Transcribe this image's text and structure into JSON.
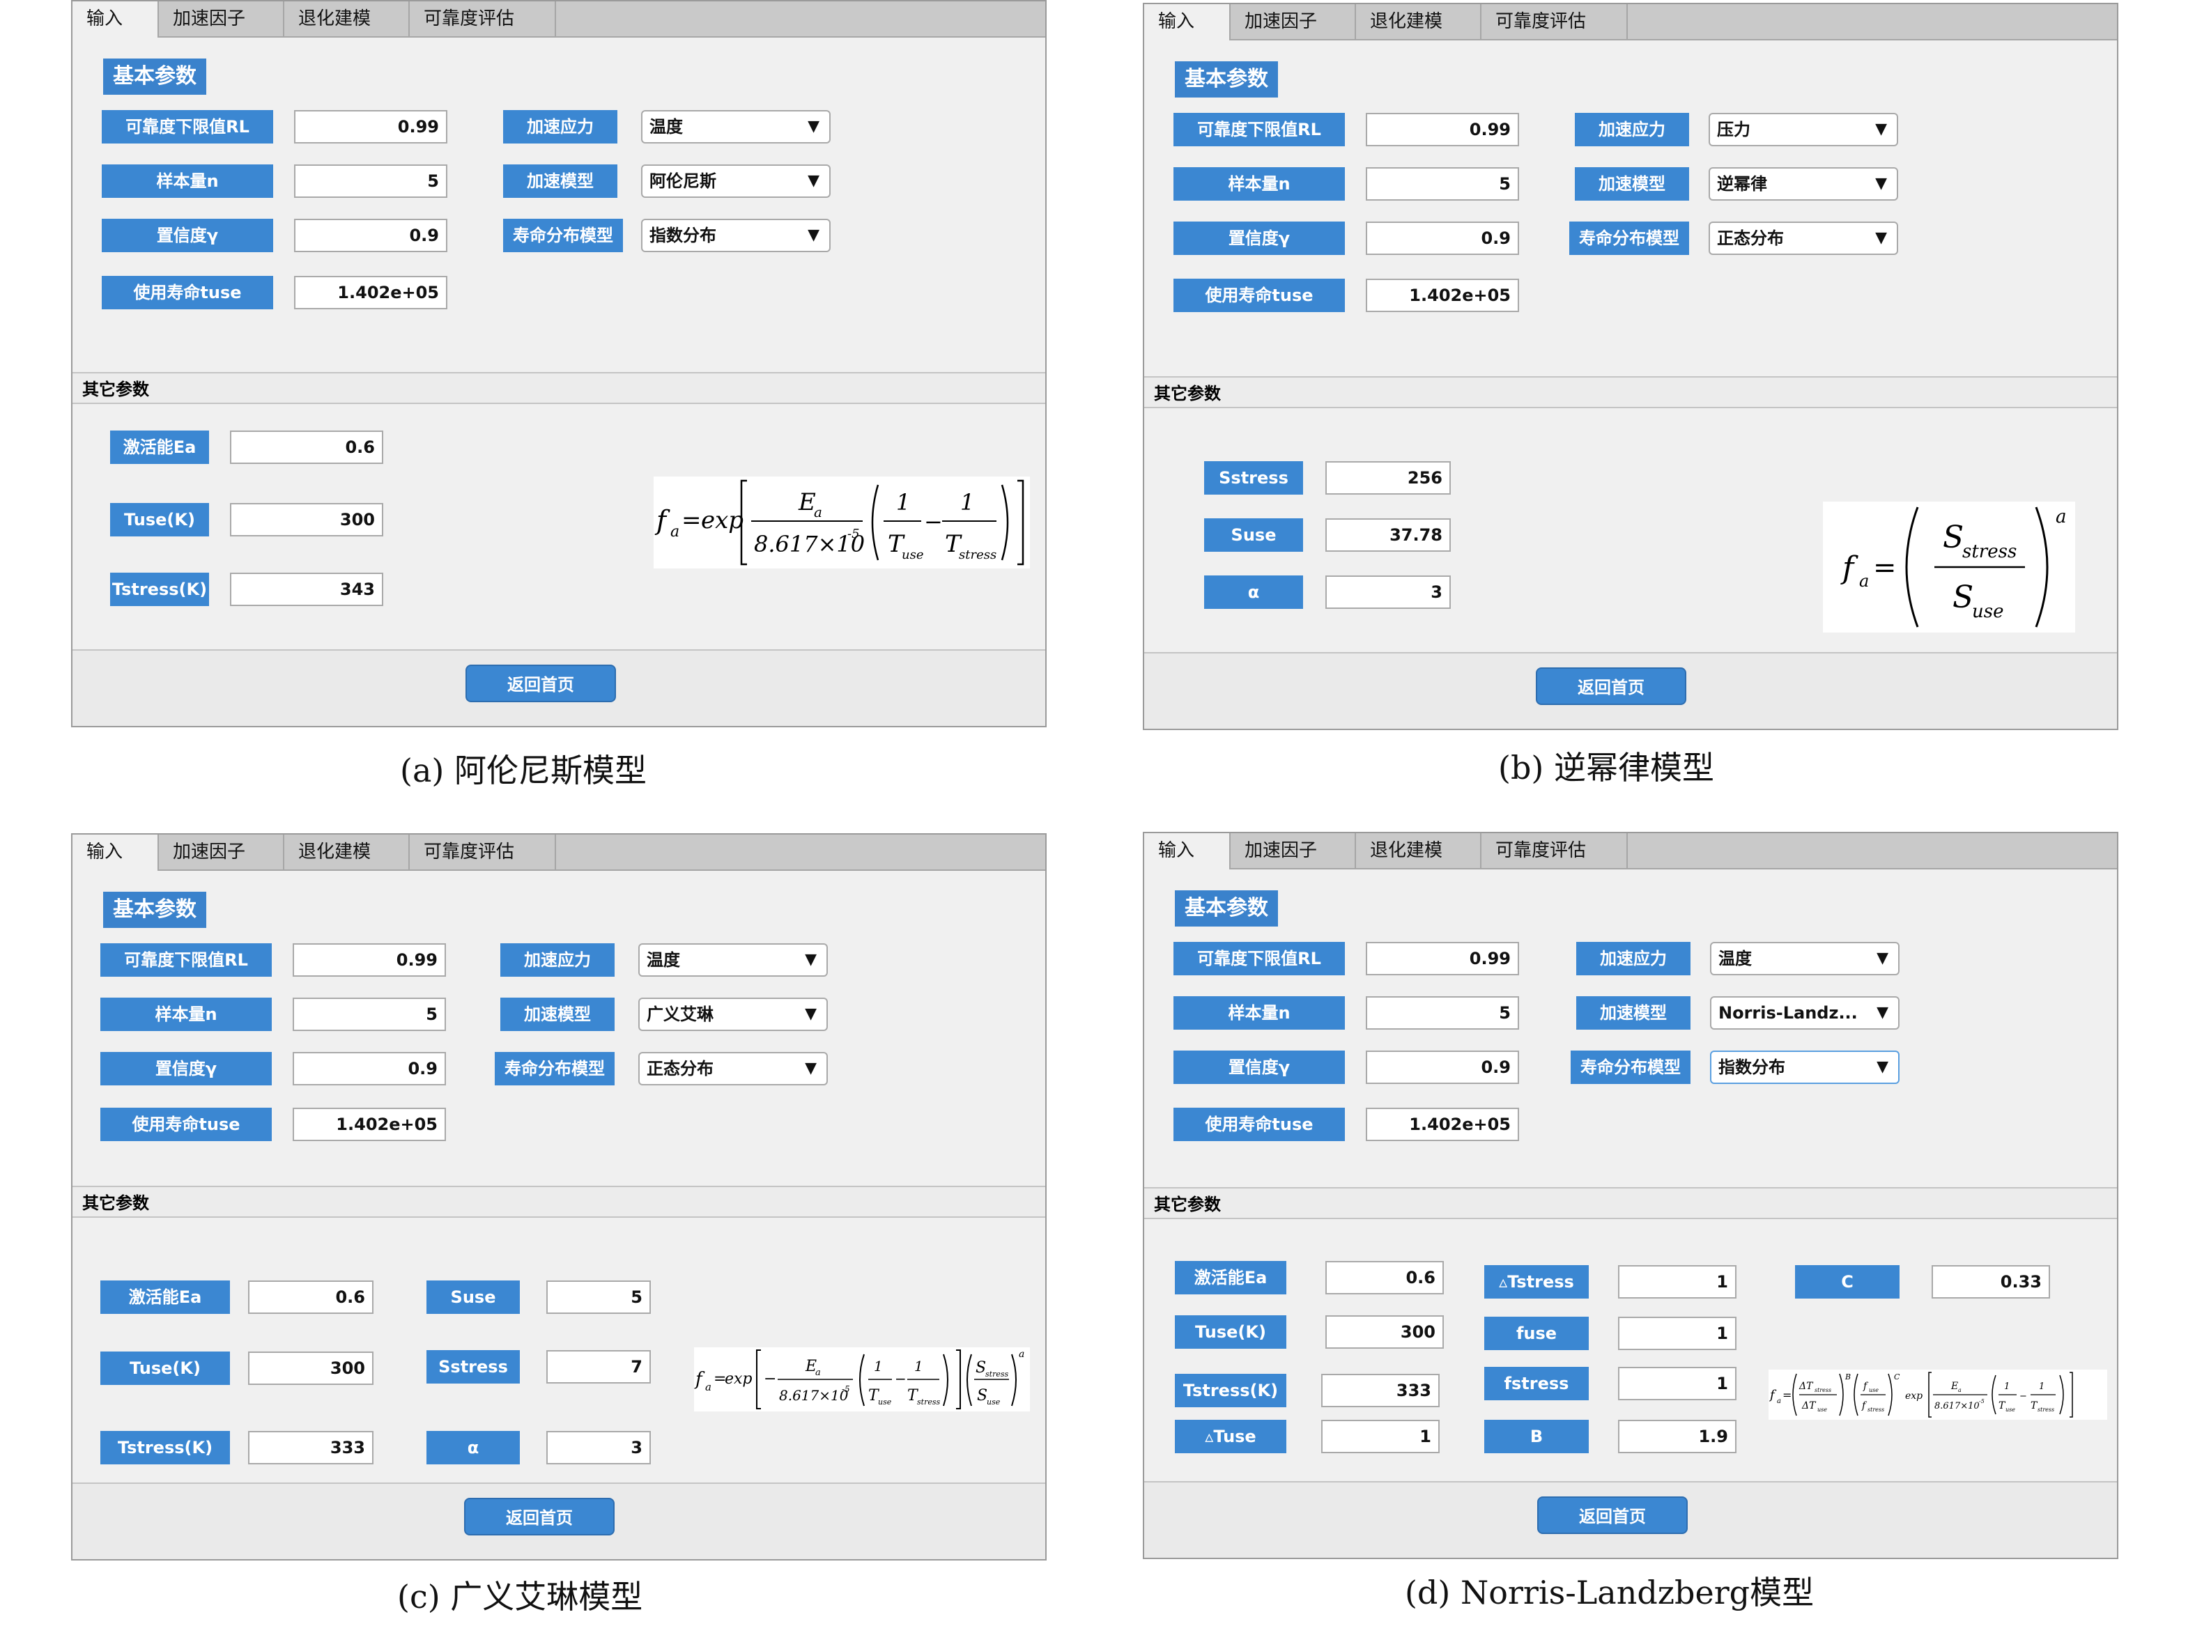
{
  "tabs": [
    "输入",
    "加速因子",
    "退化建模",
    "可靠度评估"
  ],
  "basic_title": "基本参数",
  "other_title": "其它参数",
  "home_button": "返回首页",
  "arrow": "▼",
  "basic_labels": {
    "rl": "可靠度下限值RL",
    "n": "样本量n",
    "gamma": "置信度γ",
    "tuse": "使用寿命tuse",
    "stress": "加速应力",
    "model": "加速模型",
    "dist": "寿命分布模型"
  },
  "panels": {
    "a": {
      "caption": "(a)  阿伦尼斯模型",
      "values": {
        "rl": "0.99",
        "n": "5",
        "gamma": "0.9",
        "tuse": "1.402e+05"
      },
      "selects": {
        "stress": "温度",
        "model": "阿伦尼斯",
        "dist": "指数分布"
      },
      "other": [
        {
          "label": "激活能Ea",
          "value": "0.6"
        },
        {
          "label": "Tuse(K)",
          "value": "300"
        },
        {
          "label": "Tstress(K)",
          "value": "343"
        }
      ]
    },
    "b": {
      "caption": "(b)  逆幂律模型",
      "values": {
        "rl": "0.99",
        "n": "5",
        "gamma": "0.9",
        "tuse": "1.402e+05"
      },
      "selects": {
        "stress": "压力",
        "model": "逆幂律",
        "dist": "正态分布"
      },
      "other": [
        {
          "label": "Sstress",
          "value": "256"
        },
        {
          "label": "Suse",
          "value": "37.78"
        },
        {
          "label": "α",
          "value": "3"
        }
      ]
    },
    "c": {
      "caption": "(c)  广义艾琳模型",
      "values": {
        "rl": "0.99",
        "n": "5",
        "gamma": "0.9",
        "tuse": "1.402e+05"
      },
      "selects": {
        "stress": "温度",
        "model": "广义艾琳",
        "dist": "正态分布"
      },
      "other": [
        {
          "label": "激活能Ea",
          "value": "0.6"
        },
        {
          "label": "Tuse(K)",
          "value": "300"
        },
        {
          "label": "Tstress(K)",
          "value": "333"
        },
        {
          "label": "Suse",
          "value": "5"
        },
        {
          "label": "Sstress",
          "value": "7"
        },
        {
          "label": "α",
          "value": "3"
        }
      ]
    },
    "d": {
      "caption": "(d)  Norris-Landzberg模型",
      "values": {
        "rl": "0.99",
        "n": "5",
        "gamma": "0.9",
        "tuse": "1.402e+05"
      },
      "selects": {
        "stress": "温度",
        "model": "Norris-Landz...",
        "dist": "指数分布"
      },
      "other": [
        {
          "label": "激活能Ea",
          "value": "0.6"
        },
        {
          "label": "Tuse(K)",
          "value": "300"
        },
        {
          "label": "Tstress(K)",
          "value": "333"
        },
        {
          "label": "▵Tuse",
          "value": "1"
        },
        {
          "label": "▵Tstress",
          "value": "1"
        },
        {
          "label": "fuse",
          "value": "1"
        },
        {
          "label": "fstress",
          "value": "1"
        },
        {
          "label": "B",
          "value": "1.9"
        },
        {
          "label": "C",
          "value": "0.33"
        }
      ]
    }
  },
  "formula_text": {
    "fa": "f",
    "a_sub": "a",
    "eq": "=",
    "exp": "exp",
    "const": "8.617×10",
    "exp_m5": "-5",
    "one": "1",
    "minus": "−",
    "Ea": "E",
    "T": "T",
    "use": "use",
    "stress": "stress",
    "S": "S",
    "dT": "ΔT",
    "f": "f",
    "alpha": "a",
    "B": "B",
    "C": "C"
  }
}
